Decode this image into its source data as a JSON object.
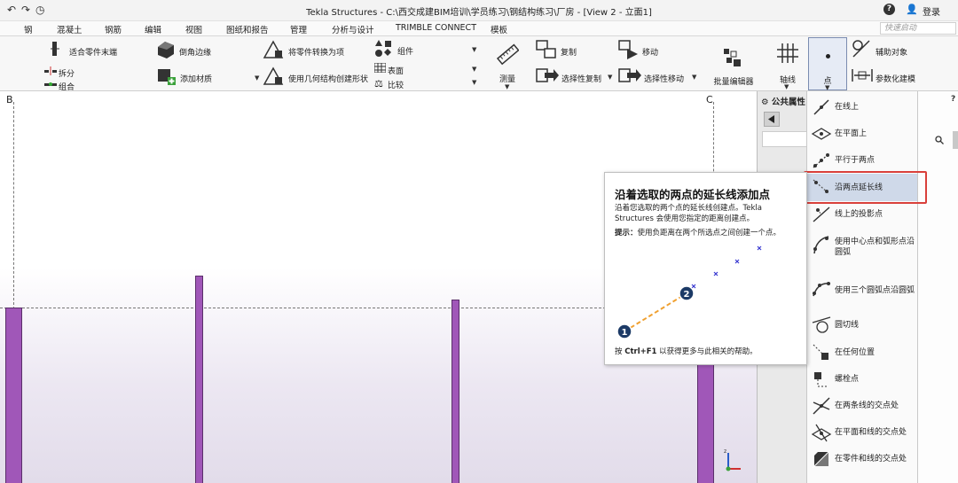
{
  "titlebar": {
    "title": "Tekla Structures - C:\\西交成建BIM培训\\学员练习\\钢结构练习\\厂房  - [View 2 - 立面1]",
    "login": "登录",
    "icons": [
      "undo-icon",
      "redo-icon",
      "history-icon",
      "help-icon",
      "user-icon"
    ]
  },
  "menu": {
    "tabs": [
      "钢",
      "混凝土",
      "钢筋",
      "编辑",
      "视图",
      "图纸和报告",
      "管理",
      "分析与设计",
      "TRIMBLE CONNECT",
      "模板"
    ],
    "active": "编辑",
    "quick_launch_placeholder": "快速启动"
  },
  "ribbon": {
    "fit_part_end": "适合零件末端",
    "split": "拆分",
    "combine": "组合",
    "chamfer_edges": "倒角边缘",
    "add_material": "添加材质",
    "convert_part_to_item": "将零件转换为项",
    "create_shape_from_geometry": "使用几何结构创建形状",
    "component": "组件",
    "surface": "表面",
    "compare": "比较",
    "measure": "测量",
    "copy": "复制",
    "copy_special": "选择性复制",
    "move": "移动",
    "move_special": "选择性移动",
    "batch_editor": "批量编辑器",
    "grid": "轴线",
    "point": "点",
    "construction_objects": "辅助对象",
    "parametric_modeling": "参数化建模"
  },
  "canvas": {
    "grid_labels": [
      "B",
      "C"
    ]
  },
  "side_panel": {
    "header": "公共属性"
  },
  "point_menu": {
    "items": [
      "在线上",
      "在平面上",
      "平行于两点",
      "沿两点延长线",
      "线上的投影点",
      "使用中心点和弧形点沿圆弧",
      "使用三个圆弧点沿圆弧",
      "圆切线",
      "在任何位置",
      "螺栓点",
      "在两条线的交点处",
      "在平面和线的交点处",
      "在零件和线的交点处"
    ],
    "highlighted": "沿两点延长线"
  },
  "tooltip": {
    "title": "沿着选取的两点的延长线添加点",
    "description": "沿着您选取的两个点的延长线创建点。Tekla Structures 会使用您指定的距离创建点。",
    "tip_label": "提示：",
    "tip_text": "使用负距离在两个所选点之间创建一个点。",
    "point_labels": [
      "1",
      "2"
    ],
    "footer_prefix": "按 ",
    "footer_key": "Ctrl+F1",
    "footer_suffix": " 以获得更多与此相关的帮助。"
  },
  "colors": {
    "member_fill": "#a057b8",
    "highlight_box": "#d9403b",
    "highlight_row": "#cfd9e9",
    "tooltip_dash": "#f0a030",
    "tooltip_point": "#1c3a66",
    "tooltip_cross": "#3a3ad0"
  }
}
